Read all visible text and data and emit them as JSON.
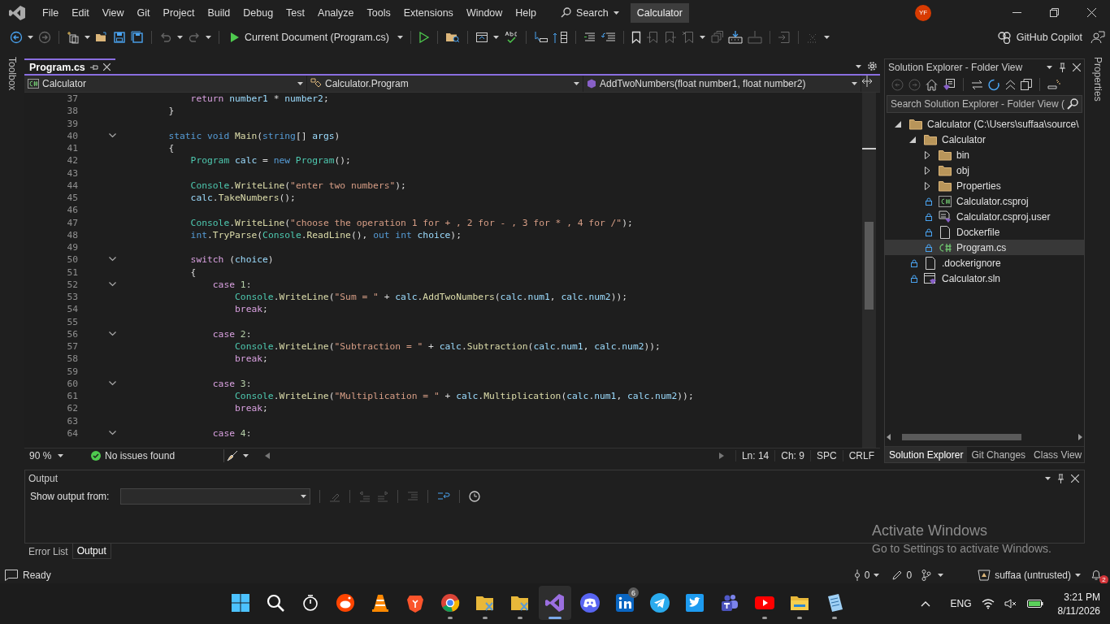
{
  "title_bar": {
    "menu": [
      "File",
      "Edit",
      "View",
      "Git",
      "Project",
      "Build",
      "Debug",
      "Test",
      "Analyze",
      "Tools",
      "Extensions",
      "Window",
      "Help"
    ],
    "search": "Search",
    "solution_name": "Calculator",
    "avatar": "YF"
  },
  "toolbar": {
    "run_target": "Current Document (Program.cs)",
    "copilot": "GitHub Copilot"
  },
  "left_strip": {
    "label": "Toolbox"
  },
  "right_strip": {
    "label": "Properties"
  },
  "editor": {
    "tabs": [
      {
        "label": "Program.cs",
        "selected": true
      }
    ],
    "navigation": [
      "Calculator",
      "Calculator.Program",
      "AddTwoNumbers(float number1, float number2)"
    ],
    "lines": [
      {
        "num": "37",
        "fold": false,
        "tokens": [
          {
            "kind": "ctl",
            "text": "            return"
          },
          {
            "kind": "var",
            "text": " number1"
          },
          {
            "kind": "p",
            "text": " * "
          },
          {
            "kind": "var",
            "text": "number2"
          },
          {
            "kind": "p",
            "text": ";"
          }
        ]
      },
      {
        "num": "38",
        "fold": false,
        "tokens": [
          {
            "kind": "p",
            "text": "        }"
          }
        ]
      },
      {
        "num": "39",
        "fold": false
      },
      {
        "num": "40",
        "fold": true,
        "tokens": [
          {
            "kind": "kw",
            "text": "        static void"
          },
          {
            "kind": "fn",
            "text": " Main"
          },
          {
            "kind": "p",
            "text": "("
          },
          {
            "kind": "kw",
            "text": "string"
          },
          {
            "kind": "p",
            "text": "[] "
          },
          {
            "kind": "var",
            "text": "args"
          },
          {
            "kind": "p",
            "text": ")"
          }
        ]
      },
      {
        "num": "41",
        "fold": false,
        "tokens": [
          {
            "kind": "p",
            "text": "        {"
          }
        ]
      },
      {
        "num": "42",
        "fold": false,
        "tokens": [
          {
            "kind": "type",
            "text": "            Program"
          },
          {
            "kind": "var",
            "text": " calc"
          },
          {
            "kind": "p",
            "text": " = "
          },
          {
            "kind": "kw",
            "text": "new"
          },
          {
            "kind": "type",
            "text": " Program"
          },
          {
            "kind": "p",
            "text": "();"
          }
        ]
      },
      {
        "num": "43",
        "fold": false
      },
      {
        "num": "44",
        "fold": false,
        "tokens": [
          {
            "kind": "type",
            "text": "            Console"
          },
          {
            "kind": "p",
            "text": "."
          },
          {
            "kind": "fn",
            "text": "WriteLine"
          },
          {
            "kind": "p",
            "text": "("
          },
          {
            "kind": "str",
            "text": "\"enter two numbers\""
          },
          {
            "kind": "p",
            "text": ");"
          }
        ]
      },
      {
        "num": "45",
        "fold": false,
        "tokens": [
          {
            "kind": "var",
            "text": "            calc"
          },
          {
            "kind": "p",
            "text": "."
          },
          {
            "kind": "fn",
            "text": "TakeNumbers"
          },
          {
            "kind": "p",
            "text": "();"
          }
        ]
      },
      {
        "num": "46",
        "fold": false
      },
      {
        "num": "47",
        "fold": false,
        "tokens": [
          {
            "kind": "type",
            "text": "            Console"
          },
          {
            "kind": "p",
            "text": "."
          },
          {
            "kind": "fn",
            "text": "WriteLine"
          },
          {
            "kind": "p",
            "text": "("
          },
          {
            "kind": "str",
            "text": "\"choose the operation 1 for + , 2 for - , 3 for * , 4 for /\""
          },
          {
            "kind": "p",
            "text": ");"
          }
        ]
      },
      {
        "num": "48",
        "fold": false,
        "tokens": [
          {
            "kind": "kw",
            "text": "            int"
          },
          {
            "kind": "p",
            "text": "."
          },
          {
            "kind": "fn",
            "text": "TryParse"
          },
          {
            "kind": "p",
            "text": "("
          },
          {
            "kind": "type",
            "text": "Console"
          },
          {
            "kind": "p",
            "text": "."
          },
          {
            "kind": "fn",
            "text": "ReadLine"
          },
          {
            "kind": "p",
            "text": "(), "
          },
          {
            "kind": "kw",
            "text": "out int"
          },
          {
            "kind": "var",
            "text": " choice"
          },
          {
            "kind": "p",
            "text": ");"
          }
        ]
      },
      {
        "num": "49",
        "fold": false
      },
      {
        "num": "50",
        "fold": true,
        "tokens": [
          {
            "kind": "ctl",
            "text": "            switch"
          },
          {
            "kind": "p",
            "text": " ("
          },
          {
            "kind": "var",
            "text": "choice"
          },
          {
            "kind": "p",
            "text": ")"
          }
        ]
      },
      {
        "num": "51",
        "fold": false,
        "tokens": [
          {
            "kind": "p",
            "text": "            {"
          }
        ]
      },
      {
        "num": "52",
        "fold": true,
        "tokens": [
          {
            "kind": "ctl",
            "text": "                case"
          },
          {
            "kind": "num",
            "text": " 1"
          },
          {
            "kind": "p",
            "text": ":"
          }
        ]
      },
      {
        "num": "53",
        "fold": false,
        "tokens": [
          {
            "kind": "type",
            "text": "                    Console"
          },
          {
            "kind": "p",
            "text": "."
          },
          {
            "kind": "fn",
            "text": "WriteLine"
          },
          {
            "kind": "p",
            "text": "("
          },
          {
            "kind": "str",
            "text": "\"Sum = \""
          },
          {
            "kind": "p",
            "text": " + "
          },
          {
            "kind": "var",
            "text": "calc"
          },
          {
            "kind": "p",
            "text": "."
          },
          {
            "kind": "fn",
            "text": "AddTwoNumbers"
          },
          {
            "kind": "p",
            "text": "("
          },
          {
            "kind": "var",
            "text": "calc"
          },
          {
            "kind": "p",
            "text": "."
          },
          {
            "kind": "var",
            "text": "num1"
          },
          {
            "kind": "p",
            "text": ", "
          },
          {
            "kind": "var",
            "text": "calc"
          },
          {
            "kind": "p",
            "text": "."
          },
          {
            "kind": "var",
            "text": "num2"
          },
          {
            "kind": "p",
            "text": "));"
          }
        ]
      },
      {
        "num": "54",
        "fold": false,
        "tokens": [
          {
            "kind": "ctl",
            "text": "                    break"
          },
          {
            "kind": "p",
            "text": ";"
          }
        ]
      },
      {
        "num": "55",
        "fold": false
      },
      {
        "num": "56",
        "fold": true,
        "tokens": [
          {
            "kind": "ctl",
            "text": "                case"
          },
          {
            "kind": "num",
            "text": " 2"
          },
          {
            "kind": "p",
            "text": ":"
          }
        ]
      },
      {
        "num": "57",
        "fold": false,
        "tokens": [
          {
            "kind": "type",
            "text": "                    Console"
          },
          {
            "kind": "p",
            "text": "."
          },
          {
            "kind": "fn",
            "text": "WriteLine"
          },
          {
            "kind": "p",
            "text": "("
          },
          {
            "kind": "str",
            "text": "\"Subtraction = \""
          },
          {
            "kind": "p",
            "text": " + "
          },
          {
            "kind": "var",
            "text": "calc"
          },
          {
            "kind": "p",
            "text": "."
          },
          {
            "kind": "fn",
            "text": "Subtraction"
          },
          {
            "kind": "p",
            "text": "("
          },
          {
            "kind": "var",
            "text": "calc"
          },
          {
            "kind": "p",
            "text": "."
          },
          {
            "kind": "var",
            "text": "num1"
          },
          {
            "kind": "p",
            "text": ", "
          },
          {
            "kind": "var",
            "text": "calc"
          },
          {
            "kind": "p",
            "text": "."
          },
          {
            "kind": "var",
            "text": "num2"
          },
          {
            "kind": "p",
            "text": "));"
          }
        ]
      },
      {
        "num": "58",
        "fold": false,
        "tokens": [
          {
            "kind": "ctl",
            "text": "                    break"
          },
          {
            "kind": "p",
            "text": ";"
          }
        ]
      },
      {
        "num": "59",
        "fold": false
      },
      {
        "num": "60",
        "fold": true,
        "tokens": [
          {
            "kind": "ctl",
            "text": "                case"
          },
          {
            "kind": "num",
            "text": " 3"
          },
          {
            "kind": "p",
            "text": ":"
          }
        ]
      },
      {
        "num": "61",
        "fold": false,
        "tokens": [
          {
            "kind": "type",
            "text": "                    Console"
          },
          {
            "kind": "p",
            "text": "."
          },
          {
            "kind": "fn",
            "text": "WriteLine"
          },
          {
            "kind": "p",
            "text": "("
          },
          {
            "kind": "str",
            "text": "\"Multiplication = \""
          },
          {
            "kind": "p",
            "text": " + "
          },
          {
            "kind": "var",
            "text": "calc"
          },
          {
            "kind": "p",
            "text": "."
          },
          {
            "kind": "fn",
            "text": "Multiplication"
          },
          {
            "kind": "p",
            "text": "("
          },
          {
            "kind": "var",
            "text": "calc"
          },
          {
            "kind": "p",
            "text": "."
          },
          {
            "kind": "var",
            "text": "num1"
          },
          {
            "kind": "p",
            "text": ", "
          },
          {
            "kind": "var",
            "text": "calc"
          },
          {
            "kind": "p",
            "text": "."
          },
          {
            "kind": "var",
            "text": "num2"
          },
          {
            "kind": "p",
            "text": "));"
          }
        ]
      },
      {
        "num": "62",
        "fold": false,
        "tokens": [
          {
            "kind": "ctl",
            "text": "                    break"
          },
          {
            "kind": "p",
            "text": ";"
          }
        ]
      },
      {
        "num": "63",
        "fold": false
      },
      {
        "num": "64",
        "fold": true,
        "tokens": [
          {
            "kind": "ctl",
            "text": "                case"
          },
          {
            "kind": "num",
            "text": " 4"
          },
          {
            "kind": "p",
            "text": ":"
          }
        ]
      }
    ],
    "status": {
      "zoom": "90 %",
      "issues": "No issues found",
      "line": "Ln: 14",
      "column": "Ch: 9",
      "whitespace": "SPC",
      "line_ending": "CRLF"
    }
  },
  "solution_explorer": {
    "title": "Solution Explorer - Folder View",
    "search_placeholder": "Search Solution Explorer - Folder View (",
    "tree": [
      {
        "label": "Calculator (C:\\Users\\suffaa\\source\\",
        "kind": "folder",
        "expanded": true,
        "selected": false,
        "locked": false,
        "children": [
          {
            "label": "Calculator",
            "kind": "folder",
            "expanded": true,
            "selected": false,
            "locked": false,
            "children": [
              {
                "label": "bin",
                "kind": "folder",
                "expanded": false,
                "selected": false,
                "locked": false
              },
              {
                "label": "obj",
                "kind": "folder",
                "expanded": false,
                "selected": false,
                "locked": false
              },
              {
                "label": "Properties",
                "kind": "folder",
                "expanded": false,
                "selected": false,
                "locked": false
              },
              {
                "label": "Calculator.csproj",
                "kind": "csproj",
                "selected": false,
                "locked": true
              },
              {
                "label": "Calculator.csproj.user",
                "kind": "user",
                "selected": false,
                "locked": true
              },
              {
                "label": "Dockerfile",
                "kind": "file",
                "selected": false,
                "locked": true
              },
              {
                "label": "Program.cs",
                "kind": "cs",
                "selected": true,
                "locked": true
              }
            ]
          },
          {
            "label": ".dockerignore",
            "kind": "file",
            "selected": false,
            "locked": true
          },
          {
            "label": "Calculator.sln",
            "kind": "sln",
            "selected": false,
            "locked": true
          }
        ]
      }
    ],
    "tabs": [
      {
        "label": "Solution Explorer",
        "selected": true
      },
      {
        "label": "Git Changes",
        "selected": false
      },
      {
        "label": "Class View",
        "selected": false
      }
    ]
  },
  "output": {
    "title": "Output",
    "source_label": "Show output from:",
    "tabs": [
      {
        "label": "Error List",
        "selected": false
      },
      {
        "label": "Output",
        "selected": true
      }
    ]
  },
  "activation": {
    "title": "Activate Windows",
    "message": "Go to Settings to activate Windows."
  },
  "status_bar": {
    "message": "Ready",
    "pending": "0",
    "changes": "0",
    "repository": "suffaa (untrusted)",
    "notifications": "2"
  },
  "taskbar": {
    "apps": [
      {
        "kind": "start",
        "running": false,
        "active": false
      },
      {
        "kind": "search",
        "running": false,
        "active": false
      },
      {
        "kind": "stopwatch",
        "running": false,
        "active": false
      },
      {
        "kind": "round",
        "running": false,
        "active": false
      },
      {
        "kind": "cone",
        "running": false,
        "active": false
      },
      {
        "kind": "shield",
        "running": false,
        "active": false
      },
      {
        "kind": "browser",
        "running": true,
        "active": false
      },
      {
        "kind": "folderx",
        "running": true,
        "active": false
      },
      {
        "kind": "folderx",
        "running": true,
        "active": false
      },
      {
        "kind": "ribbon",
        "running": true,
        "active": true
      },
      {
        "kind": "controller",
        "running": false,
        "active": false
      },
      {
        "kind": "square",
        "running": false,
        "active": false,
        "badge": "6"
      },
      {
        "kind": "plane",
        "running": false,
        "active": false
      },
      {
        "kind": "bird",
        "running": false,
        "active": false
      },
      {
        "kind": "people",
        "running": false,
        "active": false
      },
      {
        "kind": "play",
        "running": true,
        "active": false
      },
      {
        "kind": "folder",
        "running": true,
        "active": false
      },
      {
        "kind": "notebook",
        "running": true,
        "active": false
      }
    ],
    "language": "ENG",
    "time": "3:21 PM",
    "date": "8/11/2026"
  }
}
